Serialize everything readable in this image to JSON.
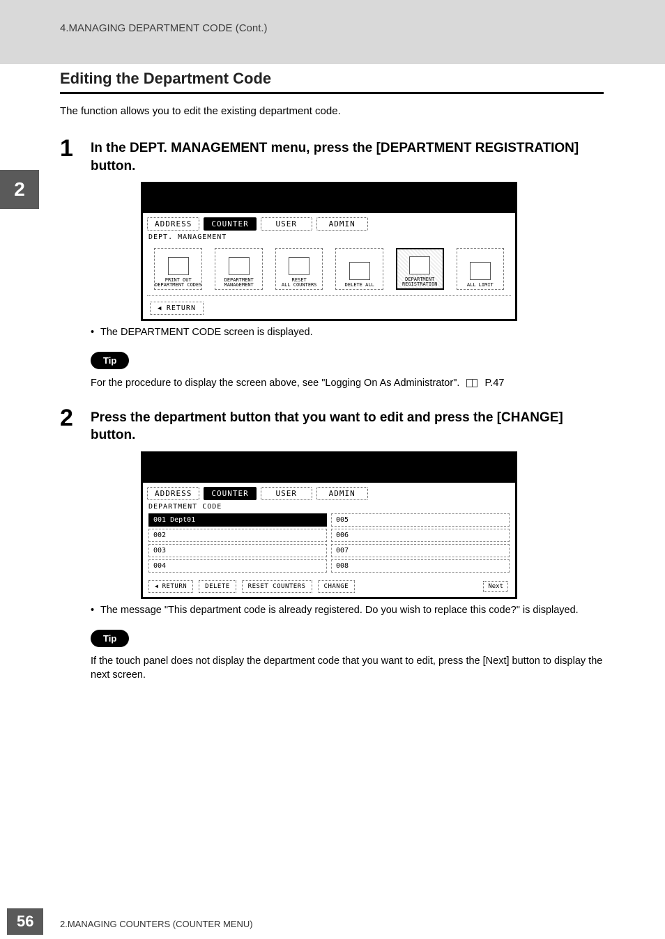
{
  "header": {
    "breadcrumb": "4.MANAGING DEPARTMENT CODE (Cont.)"
  },
  "chapter_badge": "2",
  "section_title": "Editing the Department Code",
  "intro": "The function allows you to edit the existing department code.",
  "steps": {
    "s1": {
      "num": "1",
      "text": "In the DEPT. MANAGEMENT menu, press the [DEPARTMENT REGISTRATION] button.",
      "bullet": "The DEPARTMENT CODE screen is displayed."
    },
    "s2": {
      "num": "2",
      "text": "Press the department button that you want to edit and press the [CHANGE] button.",
      "bullet": "The message \"This department code is already registered.  Do you wish to replace this code?\" is displayed."
    }
  },
  "tip_label": "Tip",
  "tip1": {
    "prefix": "For the procedure to display the screen above, see \"Logging On As Administrator\".",
    "pageref": "P.47"
  },
  "tip2": "If the touch panel does not display the department code that you want to edit, press the [Next] button to display the next screen.",
  "ss1": {
    "tabs": [
      "ADDRESS",
      "COUNTER",
      "USER",
      "ADMIN"
    ],
    "active_tab": 1,
    "subtitle": "DEPT. MANAGEMENT",
    "icons": [
      {
        "label": "PRINT OUT\nDEPARTMENT CODES"
      },
      {
        "label": "DEPARTMENT\nMANAGEMENT"
      },
      {
        "label": "RESET\nALL COUNTERS"
      },
      {
        "label": "DELETE ALL"
      },
      {
        "label": "DEPARTMENT\nREGISTRATION",
        "highlight": true
      },
      {
        "label": "ALL LIMIT"
      }
    ],
    "return": "RETURN"
  },
  "ss2": {
    "tabs": [
      "ADDRESS",
      "COUNTER",
      "USER",
      "ADMIN"
    ],
    "active_tab": 1,
    "subtitle": "DEPARTMENT CODE",
    "rows_left": [
      {
        "id": "001",
        "name": "Dept01",
        "selected": true
      },
      {
        "id": "002",
        "name": "",
        "selected": false
      },
      {
        "id": "003",
        "name": "",
        "selected": false
      },
      {
        "id": "004",
        "name": "",
        "selected": false
      }
    ],
    "rows_right": [
      {
        "id": "005"
      },
      {
        "id": "006"
      },
      {
        "id": "007"
      },
      {
        "id": "008"
      }
    ],
    "buttons": [
      "RETURN",
      "DELETE",
      "RESET COUNTERS",
      "CHANGE"
    ],
    "next": "Next"
  },
  "footer": {
    "page_num": "56",
    "text": "2.MANAGING COUNTERS (COUNTER MENU)"
  }
}
